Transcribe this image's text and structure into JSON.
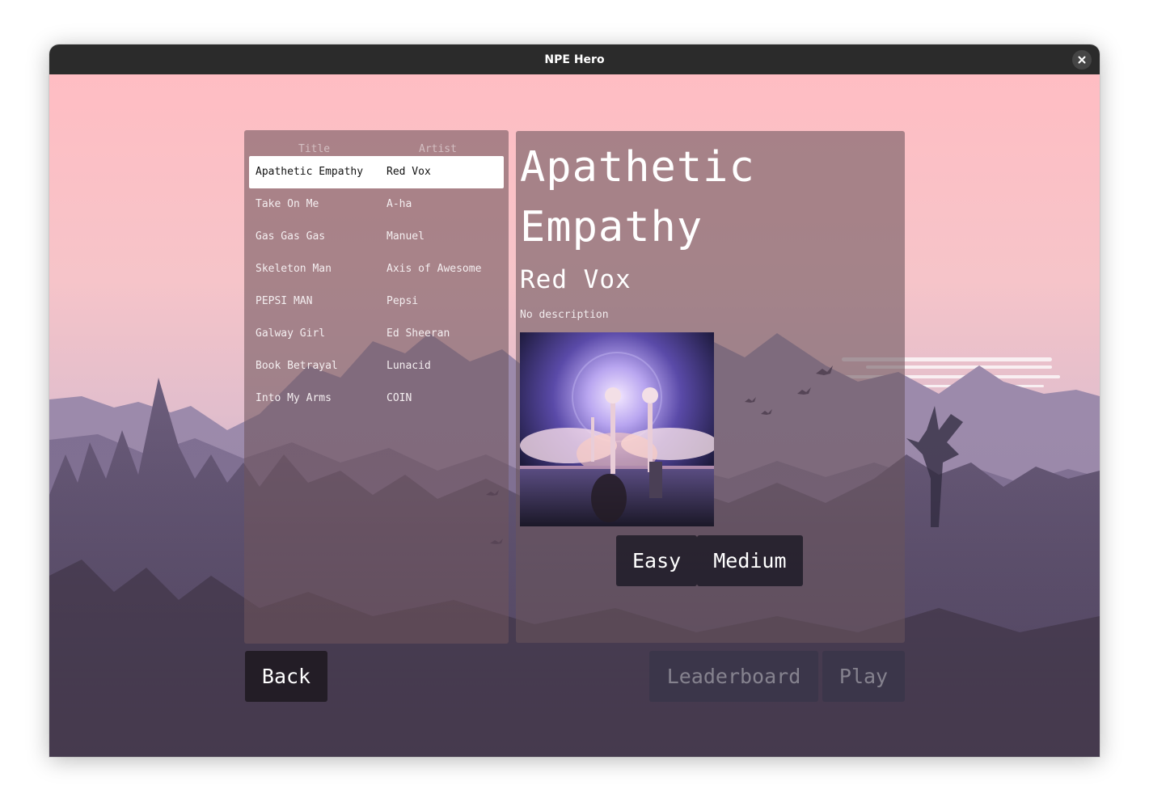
{
  "window": {
    "title": "NPE Hero",
    "close_icon": "close-icon"
  },
  "song_list": {
    "headers": {
      "title": "Title",
      "artist": "Artist"
    },
    "selected_index": 0,
    "songs": [
      {
        "title": "Apathetic Empathy",
        "artist": "Red Vox"
      },
      {
        "title": "Take On Me",
        "artist": "A-ha"
      },
      {
        "title": "Gas Gas Gas",
        "artist": "Manuel"
      },
      {
        "title": "Skeleton Man",
        "artist": "Axis of Awesome"
      },
      {
        "title": "PEPSI MAN",
        "artist": "Pepsi"
      },
      {
        "title": "Galway Girl",
        "artist": "Ed Sheeran"
      },
      {
        "title": "Book Betrayal",
        "artist": "Lunacid"
      },
      {
        "title": "Into My Arms",
        "artist": "COIN"
      }
    ]
  },
  "details": {
    "title": "Apathetic Empathy",
    "artist": "Red Vox",
    "description": "No description",
    "difficulties": [
      "Easy",
      "Medium"
    ]
  },
  "buttons": {
    "back": "Back",
    "leaderboard": "Leaderboard",
    "play": "Play"
  },
  "colors": {
    "sky_top": "#ffbdc3",
    "mountain": "#9c8aab",
    "forest_dark": "#3a2f3e",
    "selected_row": "#ffffff",
    "button_dark": "#231d26"
  }
}
